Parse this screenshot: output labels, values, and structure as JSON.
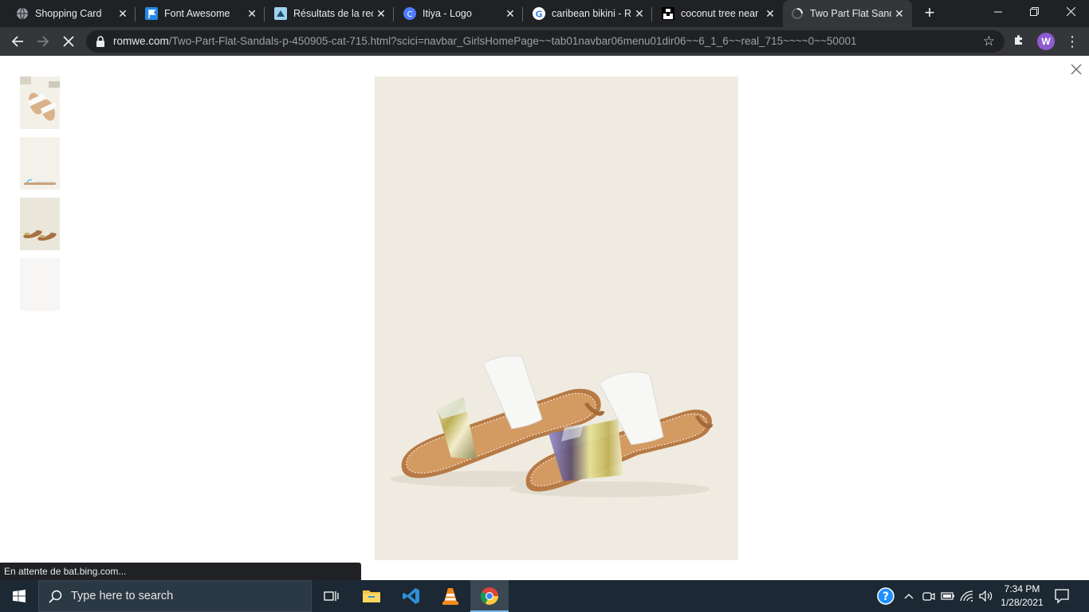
{
  "browser": {
    "tabs": [
      {
        "title": "Shopping Card",
        "icon": "globe-icon"
      },
      {
        "title": "Font Awesome",
        "icon": "flag-icon"
      },
      {
        "title": "Résultats de la rech",
        "icon": "search-results-icon"
      },
      {
        "title": "Itiya - Logo",
        "icon": "canva-icon"
      },
      {
        "title": "caribean bikini - Re",
        "icon": "google-icon"
      },
      {
        "title": "coconut tree near",
        "icon": "unsplash-icon"
      },
      {
        "title": "Two Part Flat Sand",
        "icon": "loading-icon",
        "active": true
      }
    ],
    "url_host": "romwe.com",
    "url_path": "/Two-Part-Flat-Sandals-p-450905-cat-715.html?scici=navbar_GirlsHomePage~~tab01navbar06menu01dir06~~6_1_6~~real_715~~~~0~~50001",
    "profile_initial": "W",
    "status_text": "En attente de bat.bing.com..."
  },
  "product_viewer": {
    "thumbnail_count": 4,
    "selected_thumbnail": 3,
    "main_image": "two-part-flat-sandals-photo"
  },
  "taskbar": {
    "search_placeholder": "Type here to search",
    "time": "7:34 PM",
    "date": "1/28/2021"
  },
  "colors": {
    "tabstrip": "#202124",
    "toolbar": "#35363a",
    "taskbar": "#1c2833",
    "image_bg": "#efebe1"
  }
}
